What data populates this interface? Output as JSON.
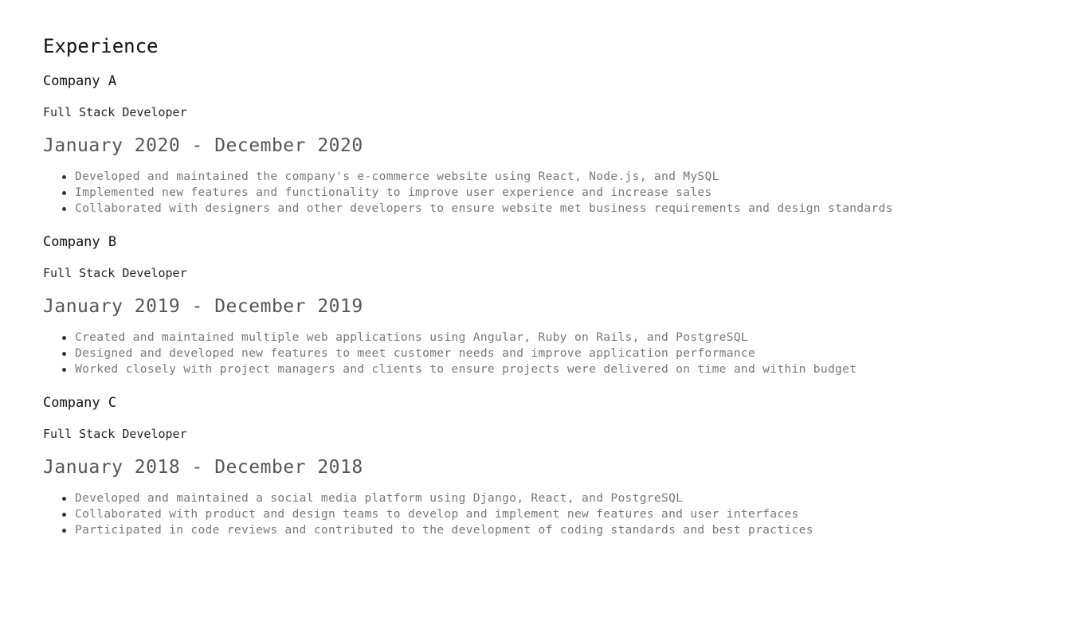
{
  "section": {
    "title": "Experience"
  },
  "jobs": [
    {
      "company": "Company A",
      "role": "Full Stack Developer",
      "dates": "January 2020 - December 2020",
      "bullets": [
        "Developed and maintained the company's e-commerce website using React, Node.js, and MySQL",
        "Implemented new features and functionality to improve user experience and increase sales",
        "Collaborated with designers and other developers to ensure website met business requirements and design standards"
      ]
    },
    {
      "company": "Company B",
      "role": "Full Stack Developer",
      "dates": "January 2019 - December 2019",
      "bullets": [
        "Created and maintained multiple web applications using Angular, Ruby on Rails, and PostgreSQL",
        "Designed and developed new features to meet customer needs and improve application performance",
        "Worked closely with project managers and clients to ensure projects were delivered on time and within budget"
      ]
    },
    {
      "company": "Company C",
      "role": "Full Stack Developer",
      "dates": "January 2018 - December 2018",
      "bullets": [
        "Developed and maintained a social media platform using Django, React, and PostgreSQL",
        "Collaborated with product and design teams to develop and implement new features and user interfaces",
        "Participated in code reviews and contributed to the development of coding standards and best practices"
      ]
    }
  ]
}
